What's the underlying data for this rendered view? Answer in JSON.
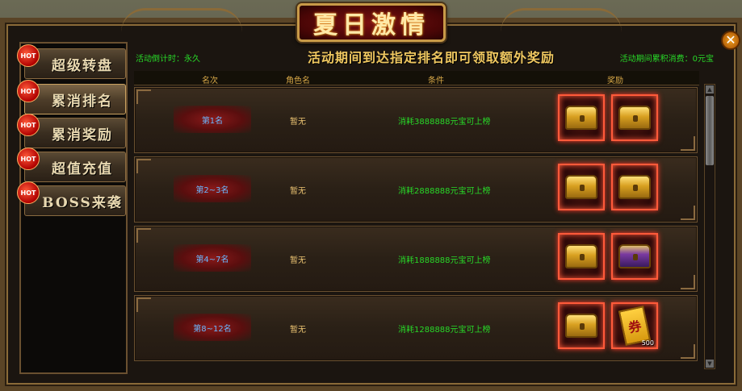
{
  "window": {
    "title": "夏日激情",
    "close_icon": "close-icon"
  },
  "sidebar": {
    "badge": "HOT",
    "items": [
      {
        "label": "超级转盘",
        "active": false
      },
      {
        "label": "累消排名",
        "active": true
      },
      {
        "label": "累消奖励",
        "active": false
      },
      {
        "label": "超值充值",
        "active": false
      },
      {
        "label": "BOSS来袭",
        "active": false
      }
    ]
  },
  "main": {
    "countdown": "活动倒计时：永久",
    "banner": "活动期间到达指定排名即可领取额外奖励",
    "consume": "活动期间累积消费：0元宝",
    "headers": {
      "rank": "名次",
      "role": "角色名",
      "condition": "条件",
      "reward": "奖励"
    },
    "rows": [
      {
        "rank": "第1名",
        "role": "暂无",
        "condition": "消耗3888888元宝可上榜",
        "rewards": [
          "gold-chest",
          "gold-chest"
        ]
      },
      {
        "rank": "第2~3名",
        "role": "暂无",
        "condition": "消耗2888888元宝可上榜",
        "rewards": [
          "gold-chest",
          "gold-chest"
        ]
      },
      {
        "rank": "第4~7名",
        "role": "暂无",
        "condition": "消耗1888888元宝可上榜",
        "rewards": [
          "gold-chest",
          "purple-chest"
        ]
      },
      {
        "rank": "第8~12名",
        "role": "暂无",
        "condition": "消耗1288888元宝可上榜",
        "rewards": [
          "gold-chest",
          "coupon"
        ]
      }
    ],
    "coupon_glyph": "券",
    "coupon_qty": "500"
  },
  "colors": {
    "accent": "#f0c860",
    "green_text": "#28d828",
    "rank_text": "#6ab8ff",
    "reward_glow": "#ff3a2a"
  }
}
